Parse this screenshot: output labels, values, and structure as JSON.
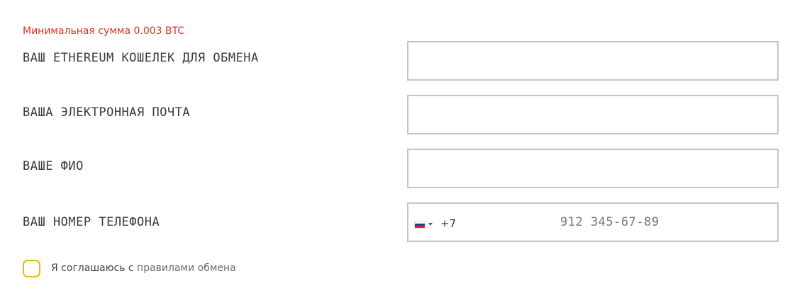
{
  "error": {
    "min_amount": "Минимальная сумма 0.003 BTC"
  },
  "form": {
    "wallet": {
      "label": "ВАШ ETHEREUM КОШЕЛЕК ДЛЯ ОБМЕНА",
      "value": "",
      "placeholder": ""
    },
    "email": {
      "label": "ВАША ЭЛЕКТРОННАЯ ПОЧТА",
      "value": "",
      "placeholder": ""
    },
    "fio": {
      "label": "ВАШЕ ФИО",
      "value": "",
      "placeholder": ""
    },
    "phone": {
      "label": "ВАШ НОМЕР ТЕЛЕФОНА",
      "country_flag": "russia-flag-icon",
      "dial_code": "+7",
      "placeholder": "912 345-67-89",
      "value": ""
    }
  },
  "agreement": {
    "text_prefix": "Я соглашаюсь с ",
    "link_text": "правилами обмена",
    "checked": false
  },
  "colors": {
    "error": "#d93025",
    "checkbox_border": "#e8b22b",
    "field_border": "#c4c4c4"
  }
}
